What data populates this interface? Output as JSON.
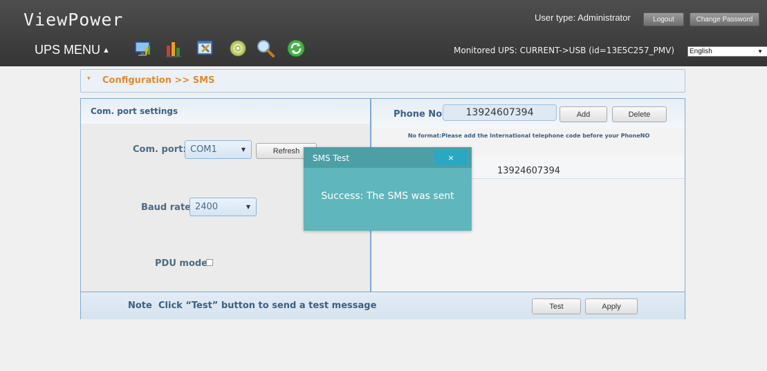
{
  "header": {
    "app_title": "ViewPower",
    "user_type": "User type: Administrator",
    "logout_label": "Logout",
    "change_password_label": "Change Password",
    "ups_menu_label": "UPS MENU",
    "ups_menu_arrow": "▲",
    "monitored": "Monitored UPS: CURRENT->USB (id=13E5C257_PMV)",
    "language": "English",
    "toolbar_icons": [
      "monitor-icon",
      "chart-icon",
      "tools-icon",
      "cd-icon",
      "search-icon",
      "refresh-icon"
    ]
  },
  "breadcrumb": {
    "text": "Configuration >> SMS"
  },
  "com_panel": {
    "title": "Com. port settings",
    "com_port_label": "Com. port:",
    "com_port_value": "COM1",
    "refresh_label": "Refresh",
    "baud_rate_label": "Baud rate:",
    "baud_rate_value": "2400",
    "pdu_mode_label": "PDU mode"
  },
  "phone_panel": {
    "phone_label": "Phone No.",
    "phone_value": "13924607394",
    "add_label": "Add",
    "delete_label": "Delete",
    "format_note": "No format:Please add the International telephone code before your PhoneNO",
    "phone_list": [
      "13924607394"
    ]
  },
  "bottom": {
    "note_label": "Note",
    "note_text": "Click “Test” button to send a test message",
    "test_label": "Test",
    "apply_label": "Apply"
  },
  "modal": {
    "title": "SMS Test",
    "close_label": "×",
    "message": "Success: The SMS was sent"
  },
  "colors": {
    "header_bg": "#3d3d3d",
    "accent_orange": "#e08a2e",
    "label_blue": "#3b5f84",
    "modal_bg": "#5fb6bc",
    "modal_close_bg": "#2aa8c3"
  }
}
